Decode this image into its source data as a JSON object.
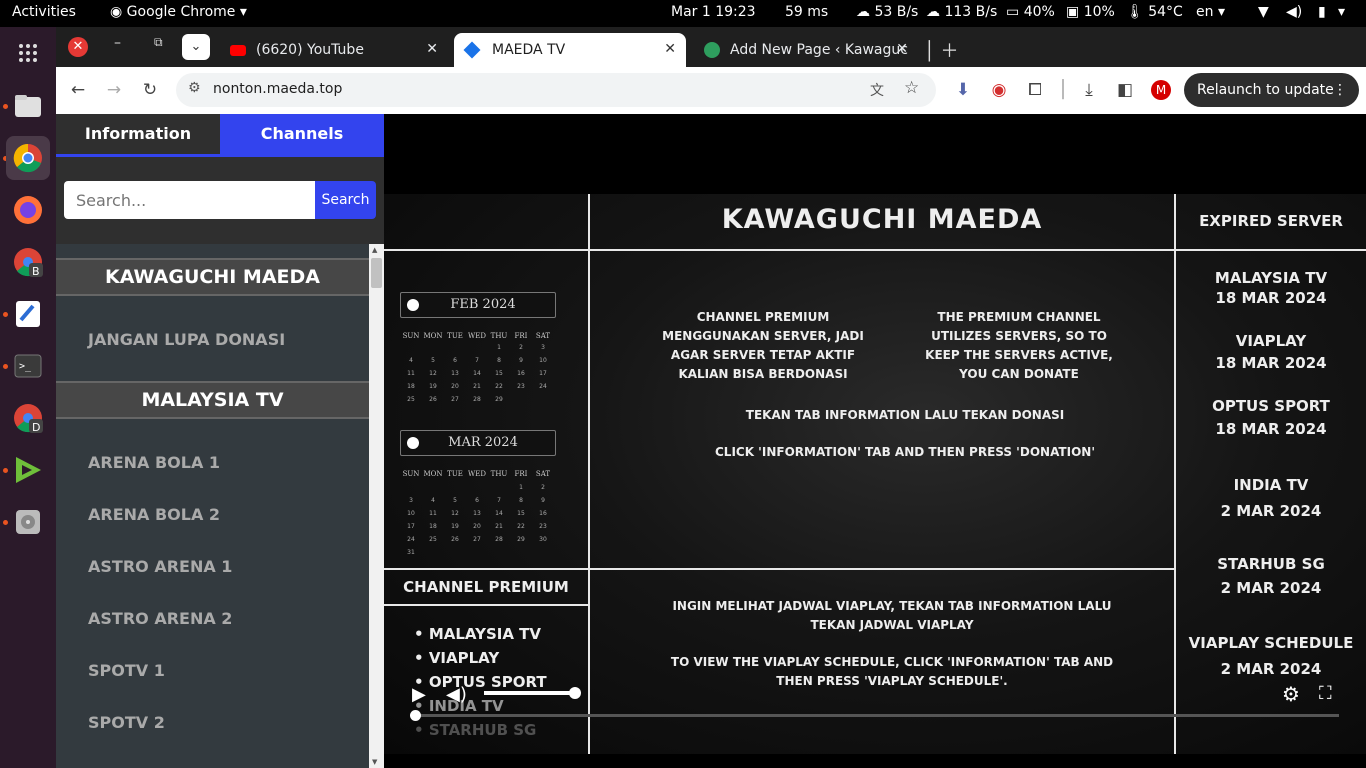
{
  "topbar": {
    "activities": "Activities",
    "app": "Google Chrome",
    "datetime": "Mar 1  19:23",
    "latency": "59 ms",
    "down": "53 B/s",
    "up": "113 B/s",
    "cpu": "40%",
    "mem": "10%",
    "temp": "54°C",
    "lang": "en"
  },
  "tabs": [
    {
      "label": "(6620) YouTube"
    },
    {
      "label": "MAEDA TV"
    },
    {
      "label": "Add New Page ‹ Kawaguc"
    }
  ],
  "toolbar": {
    "url": "nonton.maeda.top",
    "relaunch": "Relaunch to update",
    "profile": "M"
  },
  "sidebar": {
    "tab_info": "Information",
    "tab_channels": "Channels",
    "search_placeholder": "Search...",
    "search_button": "Search",
    "sections": [
      {
        "title": "KAWAGUCHI MAEDA",
        "items": [
          "JANGAN LUPA DONASI"
        ]
      },
      {
        "title": "MALAYSIA TV",
        "items": [
          "ARENA BOLA 1",
          "ARENA BOLA 2",
          "ASTRO ARENA 1",
          "ASTRO ARENA 2",
          "SPOTV 1",
          "SPOTV 2"
        ]
      }
    ]
  },
  "video": {
    "title": "KAWAGUCHI MAEDA",
    "expired_header": "EXPIRED SERVER",
    "expired": [
      {
        "name": "MALAYSIA TV",
        "date": "18 MAR 2024"
      },
      {
        "name": "VIAPLAY",
        "date": "18 MAR 2024"
      },
      {
        "name": "OPTUS SPORT",
        "date": "18 MAR 2024"
      },
      {
        "name": "INDIA TV",
        "date": "2 MAR 2024"
      },
      {
        "name": "STARHUB SG",
        "date": "2 MAR 2024"
      },
      {
        "name": "VIAPLAY SCHEDULE",
        "date": "2 MAR 2024"
      }
    ],
    "cal1": "FEB 2024",
    "cal2": "MAR 2024",
    "weekdays": [
      "SUN",
      "MON",
      "TUE",
      "WED",
      "THU",
      "FRI",
      "SAT"
    ],
    "msg_id_1": "CHANNEL PREMIUM",
    "msg_id_2": "MENGGUNAKAN SERVER, JADI",
    "msg_id_3": "AGAR SERVER TETAP AKTIF",
    "msg_id_4": "KALIAN BISA BERDONASI",
    "msg_en_1": "THE PREMIUM CHANNEL",
    "msg_en_2": "UTILIZES SERVERS, SO TO",
    "msg_en_3": "KEEP THE SERVERS ACTIVE,",
    "msg_en_4": "YOU CAN DONATE",
    "tab_id": "TEKAN TAB INFORMATION LALU TEKAN DONASI",
    "tab_en": "CLICK 'INFORMATION' TAB AND THEN PRESS 'DONATION'",
    "premium_header": "CHANNEL PREMIUM",
    "premium_list": [
      "MALAYSIA TV",
      "VIAPLAY",
      "OPTUS SPORT",
      "INDIA TV",
      "STARHUB SG"
    ],
    "sched_id_1": "INGIN MELIHAT JADWAL VIAPLAY, TEKAN TAB INFORMATION LALU",
    "sched_id_2": "TEKAN JADWAL VIAPLAY",
    "sched_en_1": "TO VIEW THE VIAPLAY SCHEDULE, CLICK 'INFORMATION' TAB AND",
    "sched_en_2": "THEN PRESS 'VIAPLAY SCHEDULE'."
  },
  "player": {
    "volume": 1.0,
    "progress": 0.0
  }
}
